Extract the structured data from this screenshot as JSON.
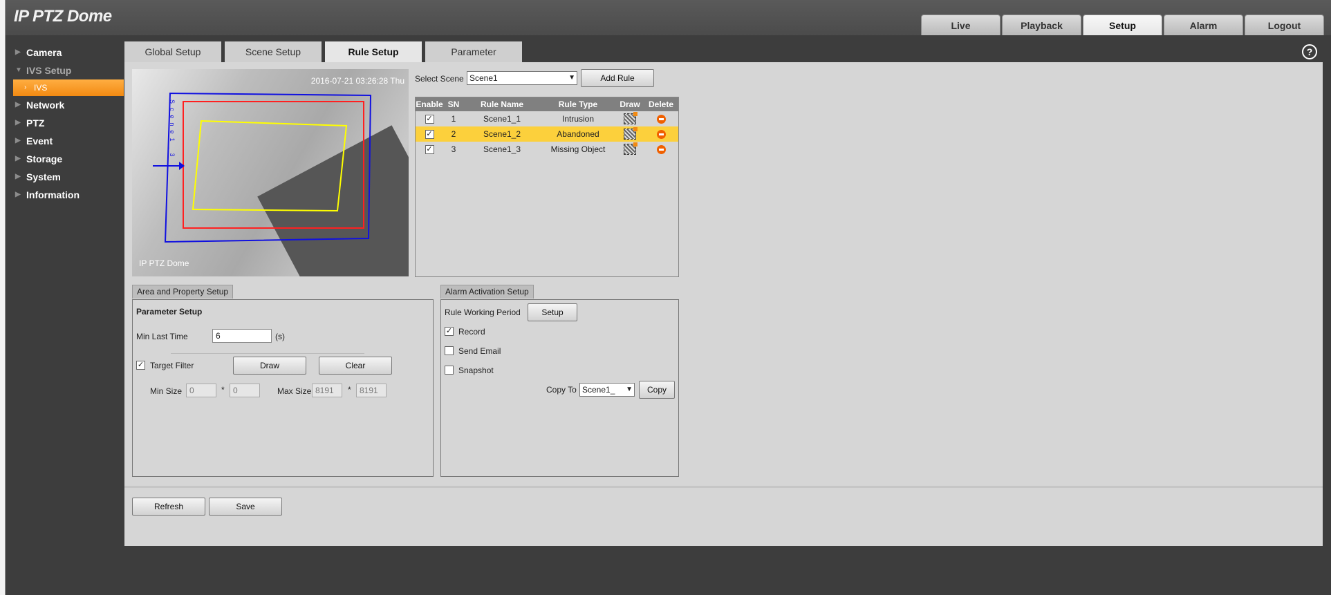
{
  "app": {
    "title": "IP PTZ Dome"
  },
  "topnav": [
    {
      "label": "Live",
      "active": false
    },
    {
      "label": "Playback",
      "active": false
    },
    {
      "label": "Setup",
      "active": true
    },
    {
      "label": "Alarm",
      "active": false
    },
    {
      "label": "Logout",
      "active": false
    }
  ],
  "sidebar": {
    "items": [
      {
        "label": "Camera"
      },
      {
        "label": "IVS Setup"
      },
      {
        "label": "IVS"
      },
      {
        "label": "Network"
      },
      {
        "label": "PTZ"
      },
      {
        "label": "Event"
      },
      {
        "label": "Storage"
      },
      {
        "label": "System"
      },
      {
        "label": "Information"
      }
    ]
  },
  "subtabs": [
    {
      "label": "Global Setup",
      "active": false
    },
    {
      "label": "Scene Setup",
      "active": false
    },
    {
      "label": "Rule Setup",
      "active": true
    },
    {
      "label": "Parameter",
      "active": false
    }
  ],
  "video": {
    "timestamp": "2016-07-21 03:26:28 Thu",
    "watermark": "IP PTZ Dome",
    "scene_label": "Scene1_3"
  },
  "scene_select": {
    "label": "Select Scene",
    "value": "Scene1"
  },
  "add_rule_label": "Add Rule",
  "rules_table": {
    "headers": [
      "Enable",
      "SN",
      "Rule Name",
      "Rule Type",
      "Draw",
      "Delete"
    ],
    "rows": [
      {
        "enabled": true,
        "sn": "1",
        "name": "Scene1_1",
        "type": "Intrusion",
        "selected": false
      },
      {
        "enabled": true,
        "sn": "2",
        "name": "Scene1_2",
        "type": "Abandoned",
        "selected": true
      },
      {
        "enabled": true,
        "sn": "3",
        "name": "Scene1_3",
        "type": "Missing Object",
        "selected": false
      }
    ]
  },
  "area_panel": {
    "tab": "Area and Property Setup",
    "section_title": "Parameter Setup",
    "min_last_time_label": "Min Last Time",
    "min_last_time_value": "6",
    "min_last_time_unit": "(s)",
    "target_filter_label": "Target Filter",
    "target_filter_checked": true,
    "draw_label": "Draw",
    "clear_label": "Clear",
    "min_size_label": "Min Size",
    "min_w": "0",
    "min_h": "0",
    "max_size_label": "Max Size",
    "max_w": "8191",
    "max_h": "8191",
    "times": "*"
  },
  "alarm_panel": {
    "tab": "Alarm Activation Setup",
    "working_period_label": "Rule Working Period",
    "setup_label": "Setup",
    "record_label": "Record",
    "record_checked": true,
    "email_label": "Send Email",
    "email_checked": false,
    "snapshot_label": "Snapshot",
    "snapshot_checked": false,
    "copy_to_label": "Copy To",
    "copy_to_value": "Scene1_",
    "copy_label": "Copy"
  },
  "footer": {
    "refresh_label": "Refresh",
    "save_label": "Save"
  },
  "colors": {
    "accent": "#f28a12",
    "selected_row": "#fcd03c",
    "header_bg": "#4b4b4b"
  }
}
